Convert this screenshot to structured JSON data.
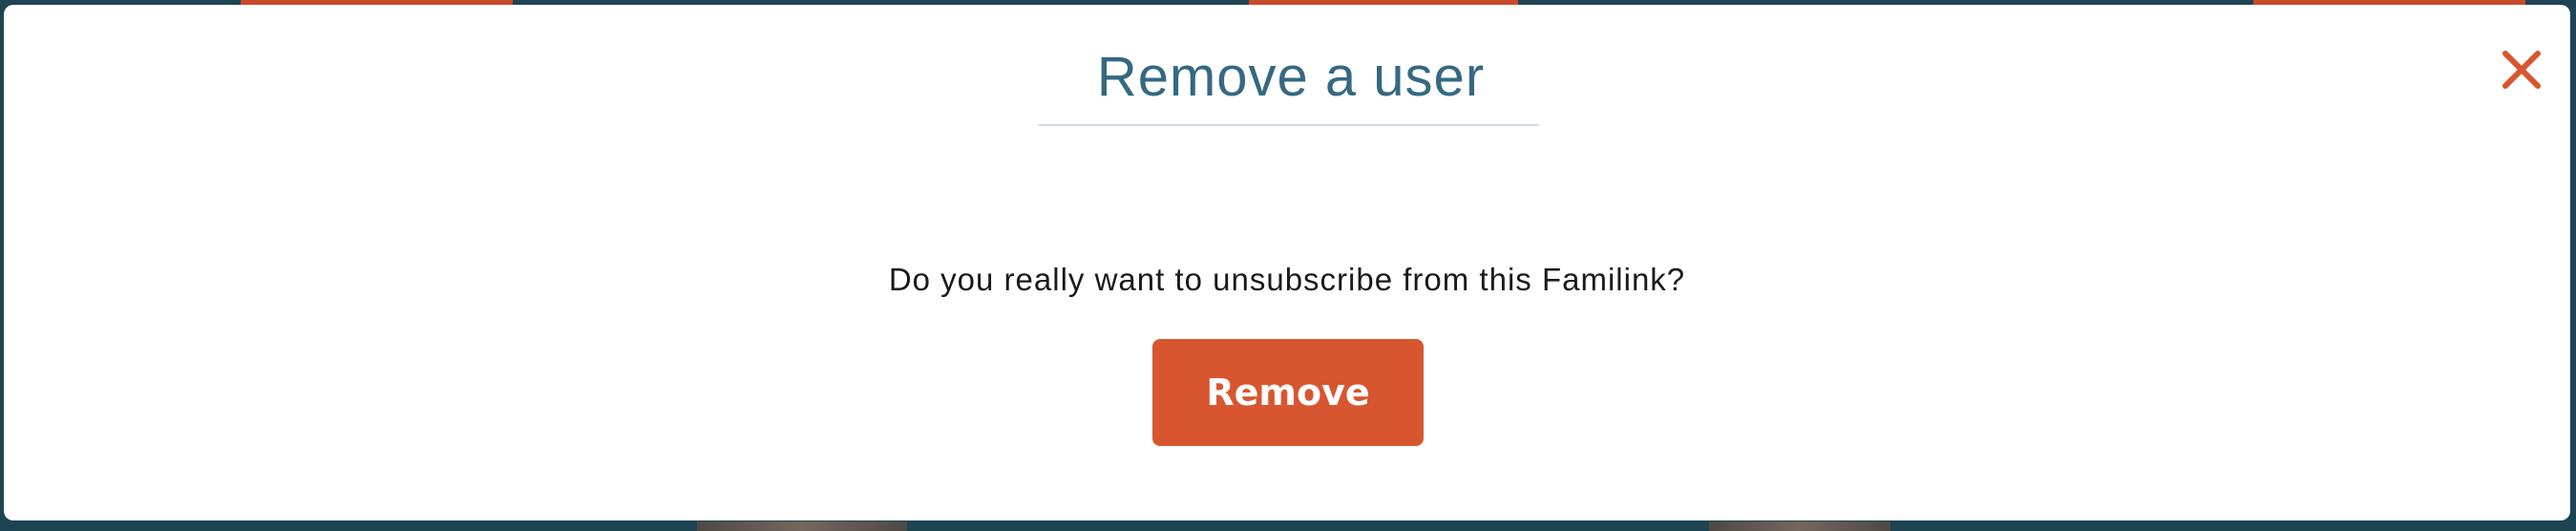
{
  "modal": {
    "title": "Remove a user",
    "message": "Do you really want to unsubscribe from this Familink?",
    "remove_label": "Remove",
    "close_icon": "close-icon"
  },
  "colors": {
    "backdrop": "#1e4352",
    "accent": "#d8562f",
    "title": "#356980",
    "modal_background": "#ffffff"
  }
}
